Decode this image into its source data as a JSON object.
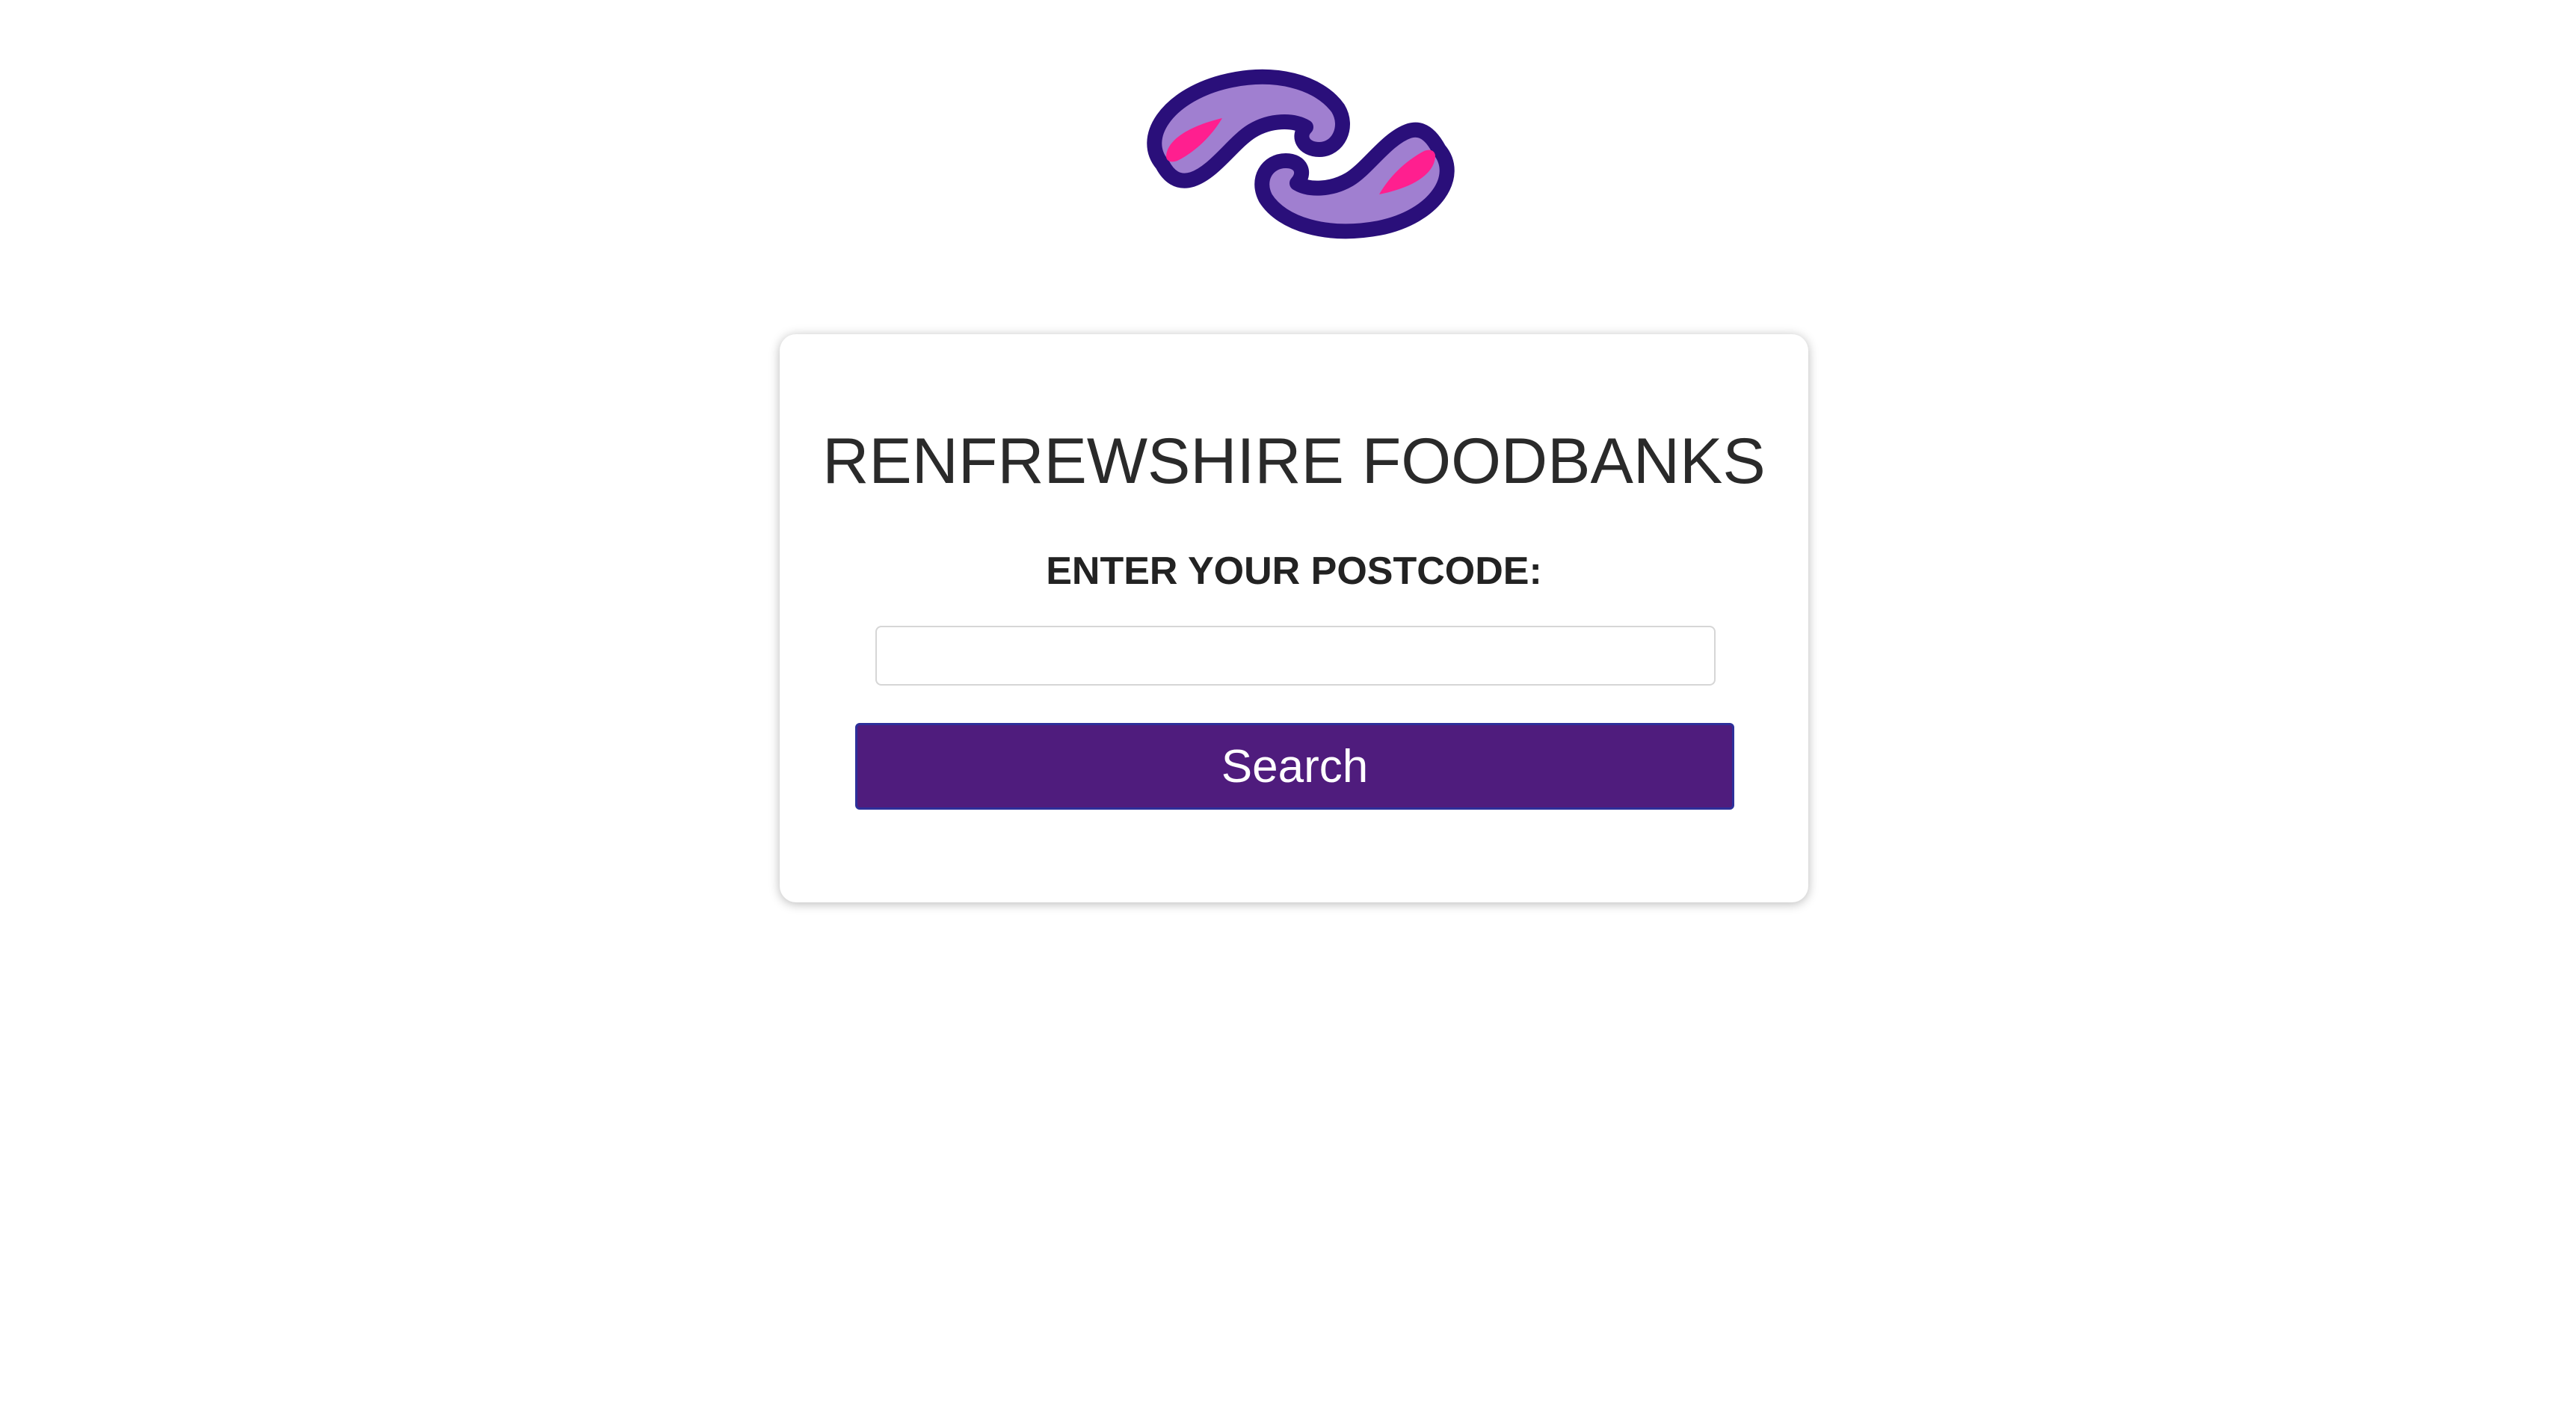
{
  "header": {
    "logo_icon": "paisley-logo-icon"
  },
  "card": {
    "title": "RENFREWSHIRE FOODBANKS",
    "postcode_label": "ENTER YOUR POSTCODE:",
    "postcode_value": "",
    "postcode_placeholder": "",
    "search_label": "Search"
  },
  "colors": {
    "brand_dark": "#2a0f7a",
    "brand_mid": "#a07fd0",
    "brand_pink": "#ff1f8f",
    "button_bg": "#4f1c7d"
  }
}
